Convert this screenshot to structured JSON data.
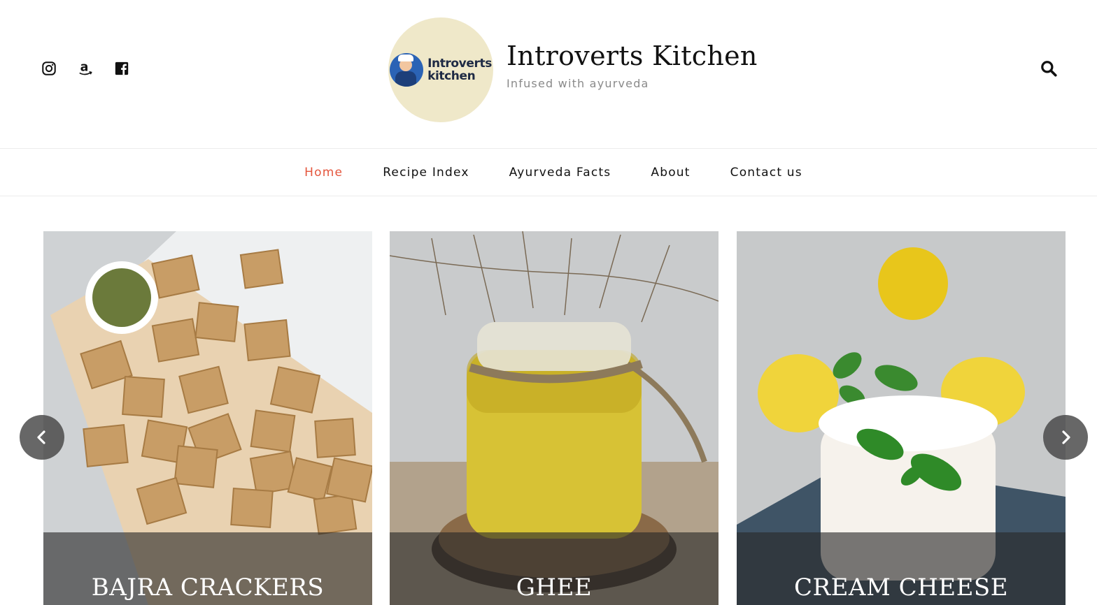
{
  "header": {
    "site_title": "Introverts Kitchen",
    "tagline": "Infused with ayurveda",
    "logo_text_line1": "Introverts",
    "logo_text_line2": "kitchen",
    "social_icons": [
      "instagram-icon",
      "amazon-icon",
      "facebook-icon"
    ],
    "search_icon": "search-icon"
  },
  "nav": {
    "items": [
      {
        "label": "Home",
        "active": true
      },
      {
        "label": "Recipe Index",
        "active": false
      },
      {
        "label": "Ayurveda Facts",
        "active": false
      },
      {
        "label": "About",
        "active": false
      },
      {
        "label": "Contact us",
        "active": false
      }
    ]
  },
  "slider": {
    "slides": [
      {
        "title": "BAJRA CRACKERS"
      },
      {
        "title": "GHEE"
      },
      {
        "title": "CREAM CHEESE"
      }
    ],
    "prev_icon": "chevron-left-icon",
    "next_icon": "chevron-right-icon"
  },
  "colors": {
    "accent": "#e4563d",
    "logo_bg": "#efe8c9",
    "text": "#111111",
    "tagline": "#8a8a8a"
  }
}
